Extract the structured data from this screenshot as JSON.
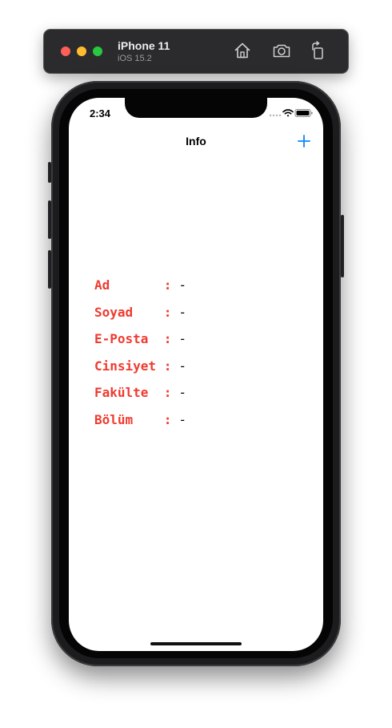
{
  "simulator": {
    "device_name": "iPhone 11",
    "os_version": "iOS 15.2",
    "toolbar_icons": [
      "home-icon",
      "screenshot-icon",
      "rotate-icon"
    ]
  },
  "status_bar": {
    "time": "2:34",
    "icons": [
      "cellular-icon",
      "wifi-icon",
      "battery-icon"
    ]
  },
  "nav": {
    "title": "Info",
    "add_button_icon": "plus-icon",
    "accent_color": "#0a84ff"
  },
  "info": {
    "label_color": "#f03a2f",
    "separator": ":",
    "rows": [
      {
        "label": "Ad",
        "value": "-"
      },
      {
        "label": "Soyad",
        "value": "-"
      },
      {
        "label": "E-Posta",
        "value": "-"
      },
      {
        "label": "Cinsiyet",
        "value": "-"
      },
      {
        "label": "Fakülte",
        "value": "-"
      },
      {
        "label": "Bölüm",
        "value": "-"
      }
    ]
  }
}
